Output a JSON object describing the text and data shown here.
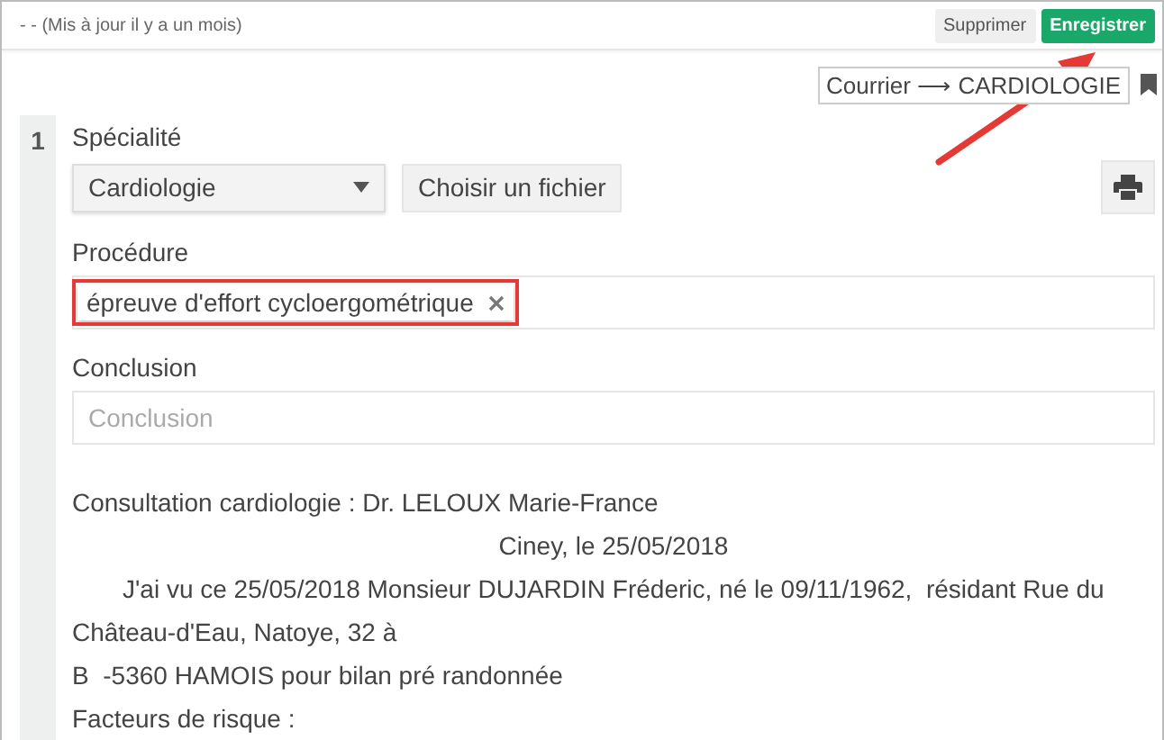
{
  "header": {
    "status": "- - (Mis à jour il y a un mois)",
    "buttons": [
      {
        "label": "Supprimer",
        "kind": "secondary"
      },
      {
        "label": "Enregistrer",
        "kind": "primary"
      }
    ]
  },
  "route_tag": "Courrier ⟶ CARDIOLOGIE",
  "section": {
    "number": "1",
    "specialty": {
      "label": "Spécialité",
      "value": "Cardiologie"
    },
    "file_button": "Choisir un fichier",
    "procedure": {
      "label": "Procédure",
      "chips": [
        "épreuve d'effort cycloergométrique"
      ]
    },
    "conclusion": {
      "label": "Conclusion",
      "placeholder": "Conclusion"
    },
    "body": [
      {
        "kind": "left",
        "text": "Consultation cardiologie : Dr. LELOUX Marie-France"
      },
      {
        "kind": "center",
        "text": "Ciney, le 25/05/2018"
      },
      {
        "kind": "indent",
        "text": "J'ai vu ce 25/05/2018 Monsieur DUJARDIN Fréderic, né le 09/11/1962,  résidant Rue du Château-d'Eau, Natoye, 32 à"
      },
      {
        "kind": "left",
        "text": "B  -5360 HAMOIS pour bilan pré randonnée"
      },
      {
        "kind": "left",
        "text": "Facteurs de risque :"
      }
    ]
  }
}
